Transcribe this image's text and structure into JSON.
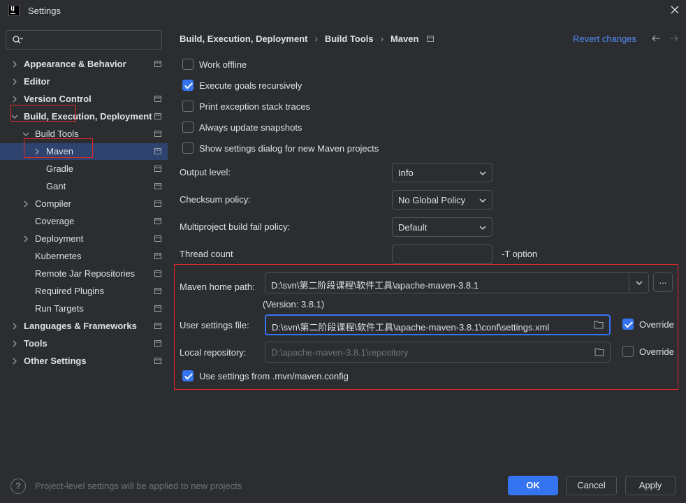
{
  "window": {
    "title": "Settings"
  },
  "sidebar": {
    "search_placeholder": "",
    "items": [
      {
        "label": "Appearance & Behavior"
      },
      {
        "label": "Editor"
      },
      {
        "label": "Version Control"
      },
      {
        "label": "Build, Execution, Deployment"
      },
      {
        "label": "Build Tools"
      },
      {
        "label": "Maven"
      },
      {
        "label": "Gradle"
      },
      {
        "label": "Gant"
      },
      {
        "label": "Compiler"
      },
      {
        "label": "Coverage"
      },
      {
        "label": "Deployment"
      },
      {
        "label": "Kubernetes"
      },
      {
        "label": "Remote Jar Repositories"
      },
      {
        "label": "Required Plugins"
      },
      {
        "label": "Run Targets"
      },
      {
        "label": "Languages & Frameworks"
      },
      {
        "label": "Tools"
      },
      {
        "label": "Other Settings"
      }
    ]
  },
  "header": {
    "breadcrumb": [
      "Build, Execution, Deployment",
      "Build Tools",
      "Maven"
    ],
    "separator": "›",
    "revert": "Revert changes"
  },
  "options": {
    "work_offline": {
      "label": "Work offline",
      "checked": false
    },
    "execute_goals": {
      "label": "Execute goals recursively",
      "checked": true
    },
    "print_exception": {
      "label": "Print exception stack traces",
      "checked": false
    },
    "always_update": {
      "label": "Always update snapshots",
      "checked": false
    },
    "show_settings": {
      "label": "Show settings dialog for new Maven projects",
      "checked": false
    }
  },
  "fields": {
    "output_level": {
      "label": "Output level:",
      "value": "Info"
    },
    "checksum_policy": {
      "label": "Checksum policy:",
      "value": "No Global Policy"
    },
    "fail_policy": {
      "label": "Multiproject build fail policy:",
      "value": "Default"
    },
    "thread_count": {
      "label": "Thread count",
      "value": "",
      "hint": "-T option"
    }
  },
  "maven": {
    "home_label": "Maven home path:",
    "home_value": "D:\\svn\\第二阶段课程\\软件工具\\apache-maven-3.8.1",
    "browse": "...",
    "version": "(Version: 3.8.1)",
    "settings_label": "User settings file:",
    "settings_value": "D:\\svn\\第二阶段课程\\软件工具\\apache-maven-3.8.1\\conf\\settings.xml",
    "settings_override": {
      "label": "Override",
      "checked": true
    },
    "repo_label": "Local repository:",
    "repo_value": "D:\\apache-maven-3.8.1\\repository",
    "repo_override": {
      "label": "Override",
      "checked": false
    },
    "use_config": {
      "label": "Use settings from .mvn/maven.config",
      "checked": true
    }
  },
  "footer": {
    "help": "?",
    "hint": "Project-level settings will be applied to new projects",
    "ok": "OK",
    "cancel": "Cancel",
    "apply": "Apply"
  },
  "colors": {
    "accent": "#3574f0",
    "selection": "#2e436e",
    "highlight_box": "#e0282a",
    "link": "#548af7"
  }
}
